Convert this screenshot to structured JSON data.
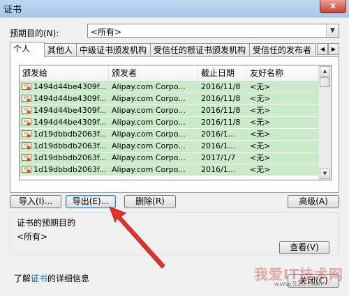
{
  "window": {
    "title": "证书",
    "close_label": "x"
  },
  "purpose": {
    "label": "预期目的(N):",
    "value": "<所有>"
  },
  "tabs": [
    {
      "label": "个人",
      "active": true
    },
    {
      "label": "其他人",
      "active": false
    },
    {
      "label": "中级证书颁发机构",
      "active": false
    },
    {
      "label": "受信任的根证书颁发机构",
      "active": false
    },
    {
      "label": "受信任的发布者",
      "active": false
    }
  ],
  "table": {
    "columns": [
      "颁发给",
      "颁发者",
      "截止日期",
      "友好名称"
    ],
    "rows": [
      [
        "1494d44be4309f...",
        "Alipay.com Corpo...",
        "2016/11/8",
        "<无>"
      ],
      [
        "1494d44be4309f...",
        "Alipay.com Corpo...",
        "2016/11/8",
        "<无>"
      ],
      [
        "1494d44be4309f...",
        "Alipay.com Corpo...",
        "2016/11/8",
        "<无>"
      ],
      [
        "1494d44be4309f...",
        "Alipay.com Corpo...",
        "2016/11/8",
        "<无>"
      ],
      [
        "1d19dbbdb2063f...",
        "Alipay.com Corpo...",
        "2016/1...",
        "<无>"
      ],
      [
        "1d19dbbdb2063f...",
        "Alipay.com Corpo...",
        "2016/1...",
        "<无>"
      ],
      [
        "1d19dbbdb2063f...",
        "Alipay.com Corpo...",
        "2017/1/7",
        "<无>"
      ],
      [
        "1d19dbbdb2063f...",
        "Alipay.com Corpo...",
        "2016/1...",
        "<无>"
      ]
    ],
    "row_highlight_color": "#c9ebc9"
  },
  "buttons": {
    "import": "导入(I)...",
    "export": "导出(E)...",
    "delete": "删除(R)",
    "advanced": "高级(A)",
    "view": "查看(V)",
    "close": "关闭(C)"
  },
  "purpose_group": {
    "title": "证书的预期目的",
    "value": "<所有>"
  },
  "learn_more": {
    "prefix": "了解",
    "link": "证书",
    "suffix": "的详细信息"
  },
  "watermark": {
    "text": "我爱IT技术网",
    "url": "www.52ij.com"
  },
  "annotation": {
    "arrow_color": "#e8302a"
  }
}
